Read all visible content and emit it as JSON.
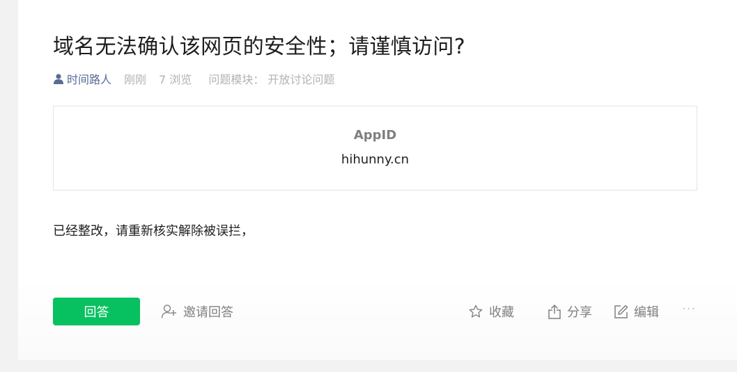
{
  "question": {
    "title": "域名无法确认该网页的安全性；请谨慎访问?",
    "author": "时间路人",
    "time": "刚刚",
    "views": "7 浏览",
    "module": "问题模块：  开放讨论问题"
  },
  "embed": {
    "label": "AppID",
    "value": "hihunny.cn"
  },
  "body": "已经整改，请重新核实解除被误拦，",
  "actions": {
    "answer": "回答",
    "invite": "邀请回答",
    "favorite": "收藏",
    "share": "分享",
    "edit": "编辑",
    "more": "···"
  },
  "colors": {
    "accent": "#07c160",
    "author_link": "#576b95",
    "muted": "#b2b2b2"
  },
  "icons": [
    "user-icon",
    "add-user-icon",
    "star-icon",
    "share-icon",
    "edit-icon",
    "more-icon"
  ]
}
